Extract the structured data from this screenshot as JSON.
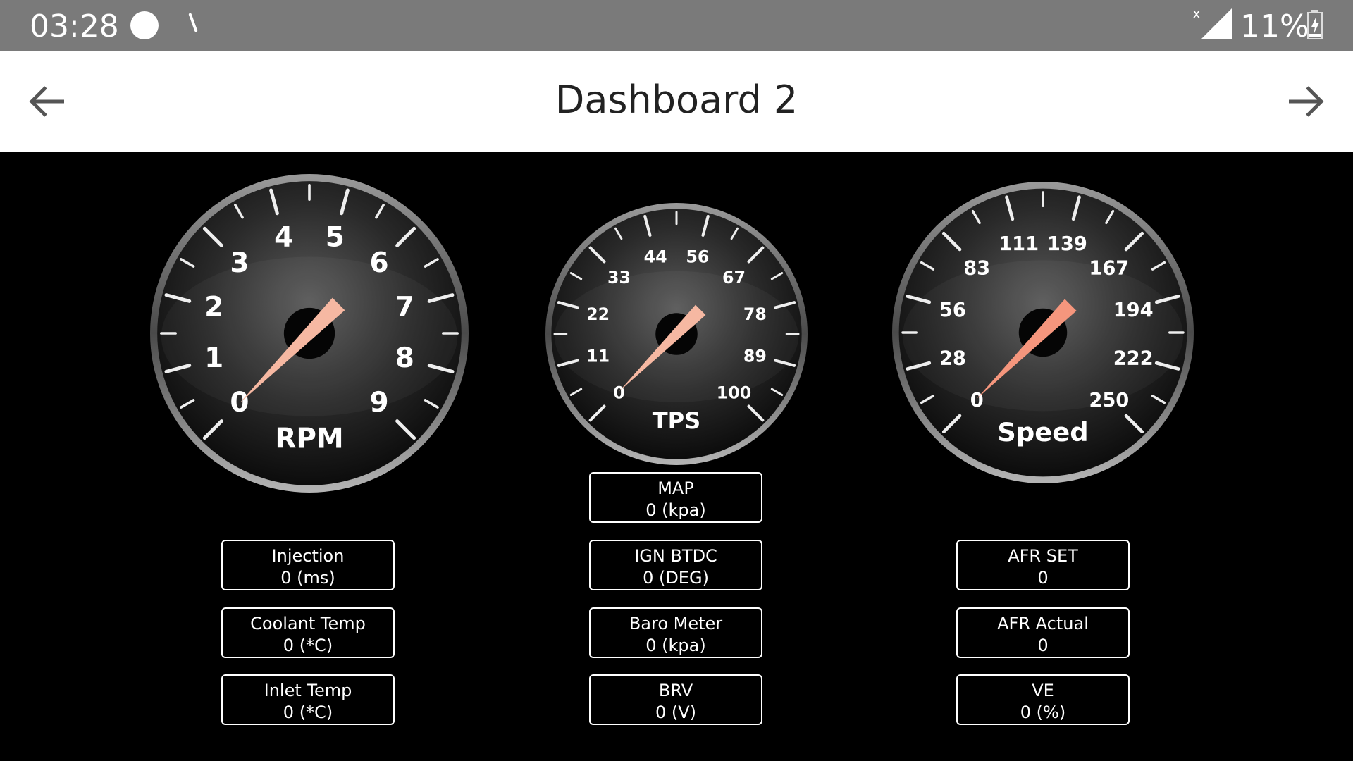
{
  "status_bar": {
    "time": "03:28",
    "battery_percent": "11%",
    "icons": [
      "notification-dot-icon",
      "signal-no-data-icon",
      "battery-charging-icon"
    ]
  },
  "app_bar": {
    "title": "Dashboard 2",
    "back_icon": "arrow-left-icon",
    "forward_icon": "arrow-right-icon"
  },
  "gauges": [
    {
      "id": "rpm",
      "label": "RPM",
      "ticks": [
        "0",
        "1",
        "2",
        "3",
        "4",
        "5",
        "6",
        "7",
        "8",
        "9"
      ],
      "value": 0,
      "needle_color": "#f6b8a2"
    },
    {
      "id": "tps",
      "label": "TPS",
      "ticks": [
        "0",
        "11",
        "22",
        "33",
        "44",
        "56",
        "67",
        "78",
        "89",
        "100"
      ],
      "value": 0,
      "needle_color": "#f6b8a2"
    },
    {
      "id": "speed",
      "label": "Speed",
      "ticks": [
        "0",
        "28",
        "56",
        "83",
        "111",
        "139",
        "167",
        "194",
        "222",
        "250"
      ],
      "value": 0,
      "needle_color": "#f5967d"
    }
  ],
  "readouts": {
    "left": [
      {
        "label": "Injection",
        "value": "0 (ms)"
      },
      {
        "label": "Coolant Temp",
        "value": "0 (*C)"
      },
      {
        "label": "Inlet Temp",
        "value": "0 (*C)"
      }
    ],
    "center": [
      {
        "label": "MAP",
        "value": "0 (kpa)"
      },
      {
        "label": "IGN BTDC",
        "value": "0 (DEG)"
      },
      {
        "label": "Baro Meter",
        "value": "0 (kpa)"
      },
      {
        "label": "BRV",
        "value": "0 (V)"
      }
    ],
    "right": [
      {
        "label": "AFR SET",
        "value": "0"
      },
      {
        "label": "AFR Actual",
        "value": "0"
      },
      {
        "label": "VE",
        "value": "0 (%)"
      }
    ]
  },
  "colors": {
    "statusbar": "#7a7a7a",
    "appbar": "#ffffff",
    "background": "#000000"
  }
}
